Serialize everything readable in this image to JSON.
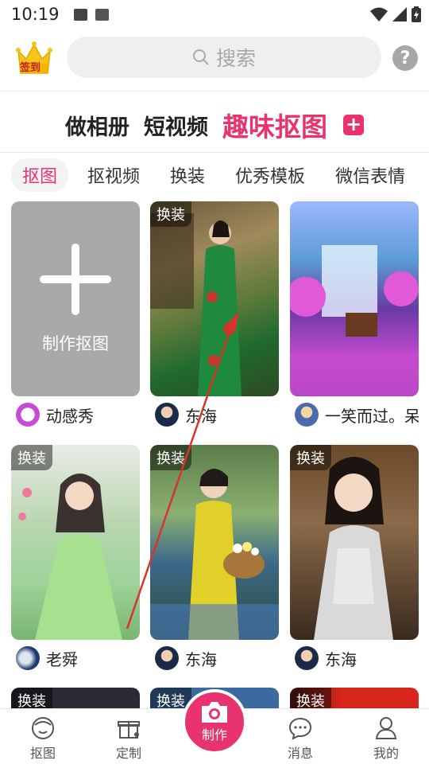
{
  "status_bar": {
    "time": "10:19"
  },
  "header": {
    "checkin_label": "签到",
    "search_placeholder": "搜索",
    "help_icon": "question-icon"
  },
  "main_tabs": [
    {
      "label": "做相册"
    },
    {
      "label": "短视频"
    },
    {
      "label": "趣味抠图",
      "active": true
    }
  ],
  "sub_tabs": [
    {
      "label": "抠图",
      "active": true
    },
    {
      "label": "抠视频"
    },
    {
      "label": "换装"
    },
    {
      "label": "优秀模板"
    },
    {
      "label": "微信表情"
    }
  ],
  "grid": {
    "make_card_label": "制作抠图",
    "items": [
      {
        "tag": "",
        "author": "动感秀"
      },
      {
        "tag": "换装",
        "author": "东海"
      },
      {
        "tag": "",
        "author": "一笑而过。呆"
      },
      {
        "tag": "换装",
        "author": "老舜"
      },
      {
        "tag": "换装",
        "author": "东海"
      },
      {
        "tag": "换装",
        "author": "东海"
      },
      {
        "tag": "换装",
        "author": ""
      },
      {
        "tag": "换装",
        "author": ""
      },
      {
        "tag": "换装",
        "author": ""
      }
    ]
  },
  "bottom_nav": {
    "items": [
      {
        "label": "抠图",
        "icon": "face-icon"
      },
      {
        "label": "定制",
        "icon": "gift-icon"
      },
      {
        "label": "制作",
        "icon": "camera-icon"
      },
      {
        "label": "消息",
        "icon": "chat-icon"
      },
      {
        "label": "我的",
        "icon": "person-icon"
      }
    ]
  },
  "colors": {
    "accent": "#e8336e",
    "tab_bg": "#f3f3f3",
    "placeholder_card": "#a9a9a9"
  }
}
